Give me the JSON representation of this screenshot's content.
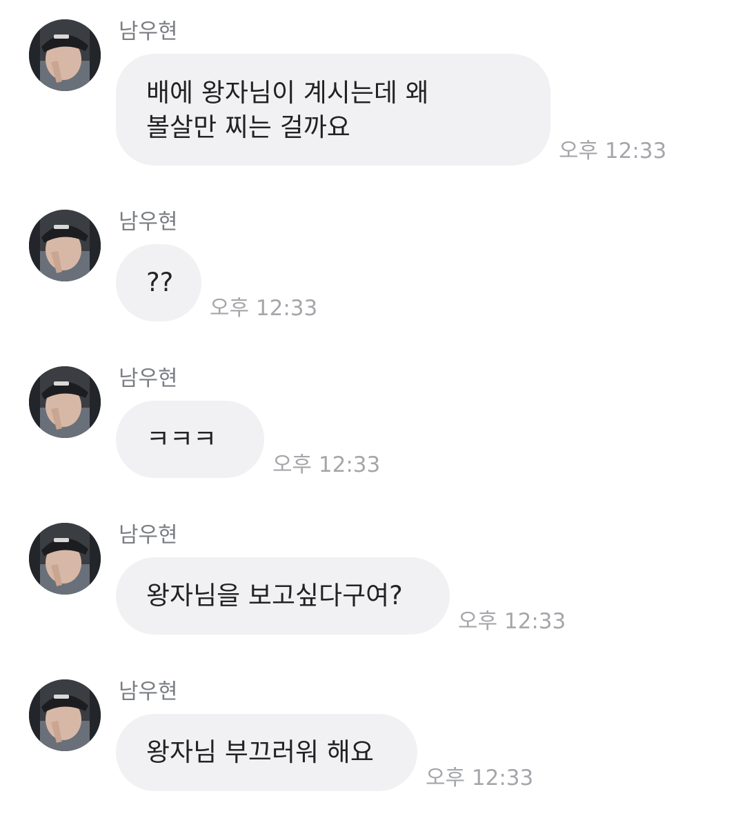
{
  "messages": [
    {
      "sender": "남우현",
      "text": "배에 왕자님이 계시는데 왜\n볼살만 찌는 걸까요",
      "time": "오후 12:33"
    },
    {
      "sender": "남우현",
      "text": "??",
      "time": "오후 12:33"
    },
    {
      "sender": "남우현",
      "text": "ㅋㅋㅋ",
      "time": "오후 12:33"
    },
    {
      "sender": "남우현",
      "text": "왕자님을 보고싶다구여?",
      "time": "오후 12:33"
    },
    {
      "sender": "남우현",
      "text": "왕자님 부끄러워 해요",
      "time": "오후 12:33"
    }
  ],
  "colors": {
    "bubble": "#f1f1f3",
    "sender_text": "#7a7d82",
    "time_text": "#a4a6aa",
    "message_text": "#222222"
  },
  "icons": {
    "avatar": "profile-photo-avatar-icon"
  }
}
